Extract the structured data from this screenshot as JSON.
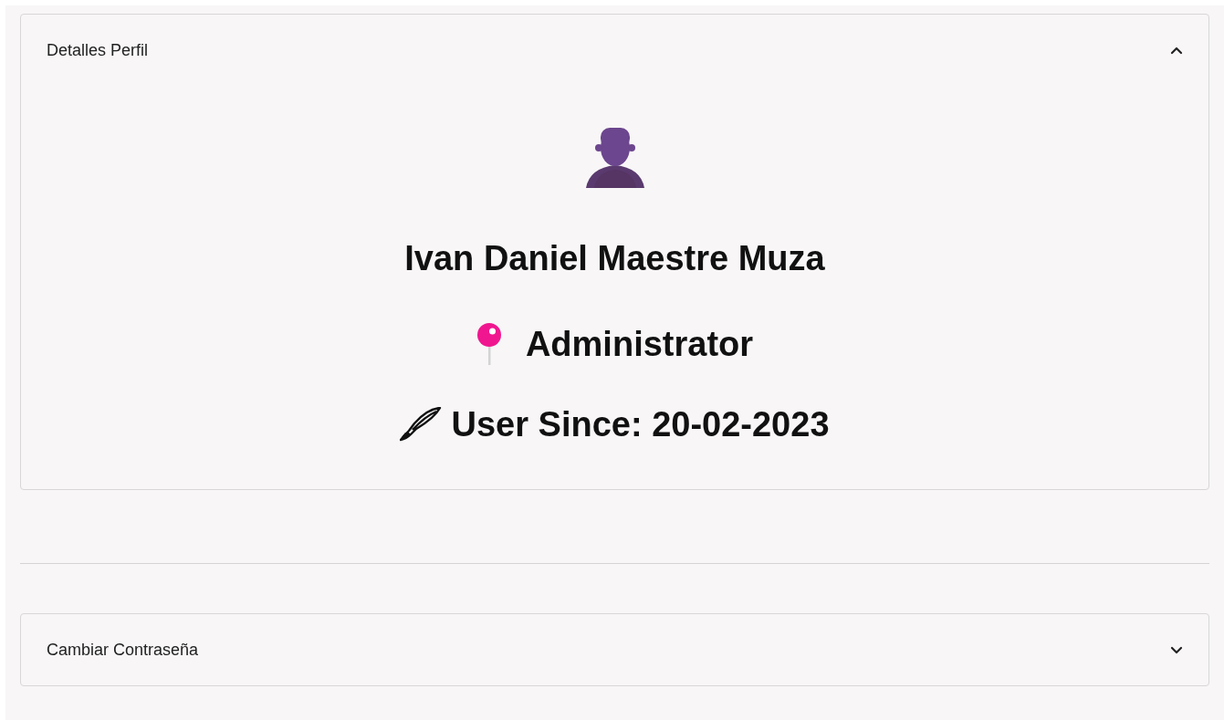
{
  "panels": [
    {
      "title": "Detalles Perfil",
      "expanded": true,
      "profile": {
        "name": "Ivan Daniel Maestre Muza",
        "role": "Administrator",
        "since": "User Since: 20-02-2023"
      }
    },
    {
      "title": "Cambiar Contraseña",
      "expanded": false
    }
  ]
}
